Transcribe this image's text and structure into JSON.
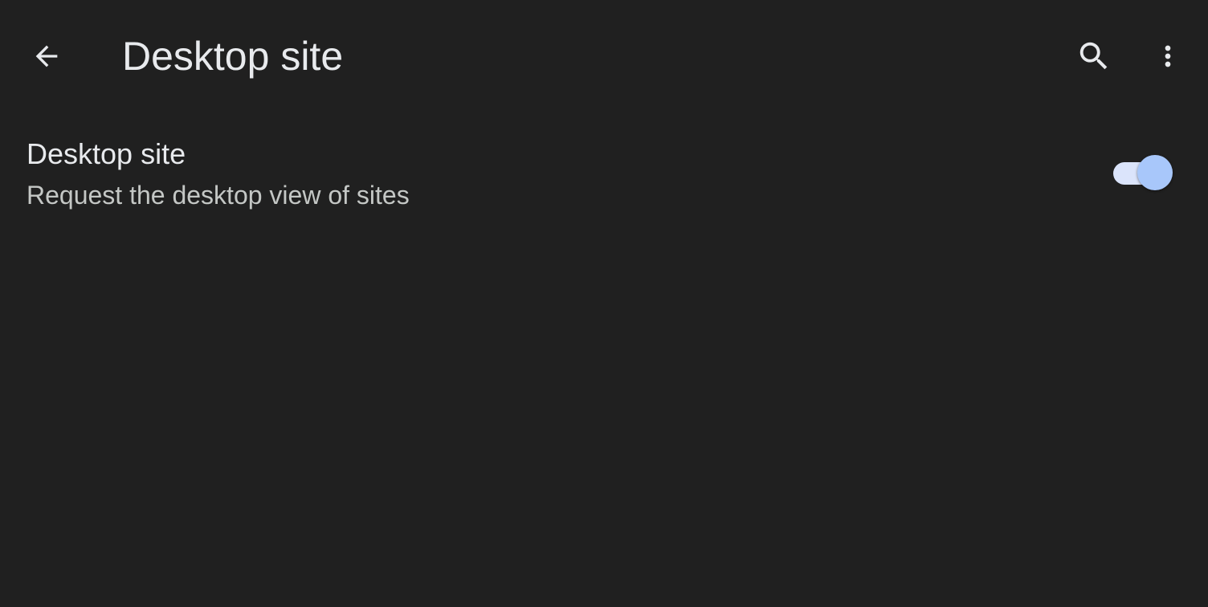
{
  "header": {
    "title": "Desktop site",
    "back_icon": "arrow-back-icon",
    "search_icon": "search-icon",
    "more_icon": "more-vert-icon"
  },
  "setting": {
    "title": "Desktop site",
    "summary": "Request the desktop view of sites",
    "toggle_on": true
  },
  "colors": {
    "background": "#202020",
    "text_primary": "#e8eaed",
    "text_secondary": "#c4c7c5",
    "toggle_track": "#dbe4fb",
    "toggle_thumb": "#a8c7fa"
  }
}
